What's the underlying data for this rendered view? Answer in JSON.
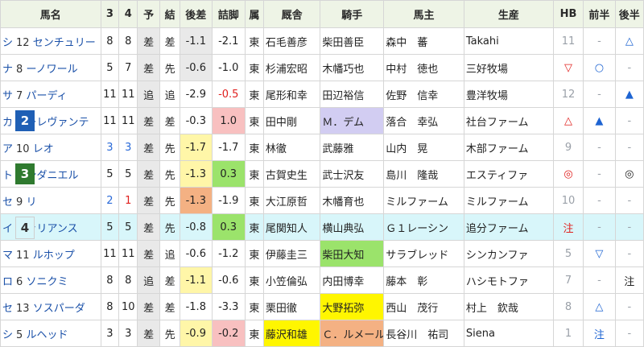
{
  "headers": [
    "馬名",
    "3",
    "4",
    "予",
    "結",
    "後差",
    "詰脚",
    "属",
    "厩舎",
    "騎手",
    "馬主",
    "生産",
    "HB",
    "前半",
    "後半"
  ],
  "colors": {
    "header_bg": "#eef4e6",
    "yellow": "#fff6a8",
    "orange": "#f4b183",
    "green": "#9be36b",
    "pink": "#f8c0c0",
    "lavender": "#d2cdf2",
    "gray": "#e9e9e9",
    "cyan_row": "#d8f6fa",
    "badge_blue": "#1f5fb5",
    "badge_green": "#2f7a2f"
  },
  "rows": [
    {
      "pre": "シ",
      "num": "12",
      "name": "センチュリー",
      "c3": "8",
      "c4": "8",
      "yo": "差",
      "ke": "差",
      "kosa": "-1.1",
      "tsume": "-2.1",
      "zoku": "東",
      "kyusha": "石毛善彦",
      "kishu": "柴田善臣",
      "owner": "森中　蕃",
      "seisan": "Takahi",
      "hb": "11",
      "zen": "-",
      "kou": "△"
    },
    {
      "pre": "ナ",
      "num": "8",
      "name": "ーノワール",
      "c3": "5",
      "c4": "7",
      "yo": "差",
      "ke": "先",
      "kosa": "-0.6",
      "tsume": "-1.0",
      "zoku": "東",
      "kyusha": "杉浦宏昭",
      "kishu": "木幡巧也",
      "owner": "中村　徳也",
      "seisan": "三好牧場",
      "hb": "▽",
      "zen": "○",
      "kou": "-"
    },
    {
      "pre": "サ",
      "num": "7",
      "name": "パーディ",
      "c3": "11",
      "c4": "11",
      "yo": "追",
      "ke": "追",
      "kosa": "-2.9",
      "tsume": "-0.5",
      "zoku": "東",
      "kyusha": "尾形和幸",
      "kishu": "田辺裕信",
      "owner": "佐野　信幸",
      "seisan": "豊洋牧場",
      "hb": "12",
      "zen": "-",
      "kou": "▲"
    },
    {
      "pre": "カ",
      "num": "2",
      "name": "ーレヴァンテ",
      "c3": "11",
      "c4": "11",
      "yo": "差",
      "ke": "差",
      "kosa": "-0.3",
      "tsume": "1.0",
      "zoku": "東",
      "kyusha": "田中剛",
      "kishu": "Ｍ．デム",
      "owner": "落合　幸弘",
      "seisan": "社台ファーム",
      "hb": "△",
      "zen": "▲",
      "kou": "-"
    },
    {
      "pre": "ア",
      "num": "10",
      "name": "レオ",
      "c3": "3",
      "c4": "3",
      "yo": "差",
      "ke": "先",
      "kosa": "-1.7",
      "tsume": "-1.7",
      "zoku": "東",
      "kyusha": "林徹",
      "kishu": "武藤雅",
      "owner": "山内　晃",
      "seisan": "木部ファーム",
      "hb": "9",
      "zen": "-",
      "kou": "-"
    },
    {
      "pre": "ト",
      "num": "3",
      "name": "ンダニエル",
      "c3": "5",
      "c4": "5",
      "yo": "差",
      "ke": "先",
      "kosa": "-1.3",
      "tsume": "0.3",
      "zoku": "東",
      "kyusha": "古賀史生",
      "kishu": "武士沢友",
      "owner": "島川　隆哉",
      "seisan": "エスティファ",
      "hb": "◎",
      "zen": "-",
      "kou": "◎"
    },
    {
      "pre": "セ",
      "num": "9",
      "name": "リ",
      "c3": "2",
      "c4": "1",
      "yo": "差",
      "ke": "先",
      "kosa": "-1.3",
      "tsume": "-1.9",
      "zoku": "東",
      "kyusha": "大江原哲",
      "kishu": "木幡育也",
      "owner": "ミルファーム",
      "seisan": "ミルファーム",
      "hb": "10",
      "zen": "-",
      "kou": "-"
    },
    {
      "pre": "イ",
      "num": "4",
      "name": "ァリアンス",
      "c3": "5",
      "c4": "5",
      "yo": "差",
      "ke": "先",
      "kosa": "-0.8",
      "tsume": "0.3",
      "zoku": "東",
      "kyusha": "尾関知人",
      "kishu": "横山典弘",
      "owner": "Ｇ１レーシン",
      "seisan": "追分ファーム",
      "hb": "注",
      "zen": "-",
      "kou": "-"
    },
    {
      "pre": "マ",
      "num": "11",
      "name": "ルホップ",
      "c3": "11",
      "c4": "11",
      "yo": "差",
      "ke": "追",
      "kosa": "-0.6",
      "tsume": "-1.2",
      "zoku": "東",
      "kyusha": "伊藤圭三",
      "kishu": "柴田大知",
      "owner": "サラブレッド",
      "seisan": "シンカンファ",
      "hb": "5",
      "zen": "▽",
      "kou": "-"
    },
    {
      "pre": "ロ",
      "num": "6",
      "name": "ソニクミ",
      "c3": "8",
      "c4": "8",
      "yo": "追",
      "ke": "差",
      "kosa": "-1.1",
      "tsume": "-0.6",
      "zoku": "東",
      "kyusha": "小笠倫弘",
      "kishu": "内田博幸",
      "owner": "藤本　彰",
      "seisan": "ハシモトファ",
      "hb": "7",
      "zen": "-",
      "kou": "注"
    },
    {
      "pre": "セ",
      "num": "13",
      "name": "ソスパーダ",
      "c3": "8",
      "c4": "10",
      "yo": "差",
      "ke": "差",
      "kosa": "-1.8",
      "tsume": "-3.3",
      "zoku": "東",
      "kyusha": "栗田徹",
      "kishu": "大野拓弥",
      "owner": "西山　茂行",
      "seisan": "村上　欽哉",
      "hb": "8",
      "zen": "△",
      "kou": "-"
    },
    {
      "pre": "シ",
      "num": "5",
      "name": "ルヘッド",
      "c3": "3",
      "c4": "3",
      "yo": "差",
      "ke": "先",
      "kosa": "-0.9",
      "tsume": "-0.2",
      "zoku": "東",
      "kyusha": "藤沢和雄",
      "kishu": "Ｃ．ルメール",
      "owner": "長谷川　祐司",
      "seisan": "Siena",
      "hb": "1",
      "zen": "注",
      "kou": "-"
    }
  ],
  "badges": {
    "2": "#1f5fb5",
    "3": "#2f7a2f",
    "4": "#d8f6fa"
  }
}
